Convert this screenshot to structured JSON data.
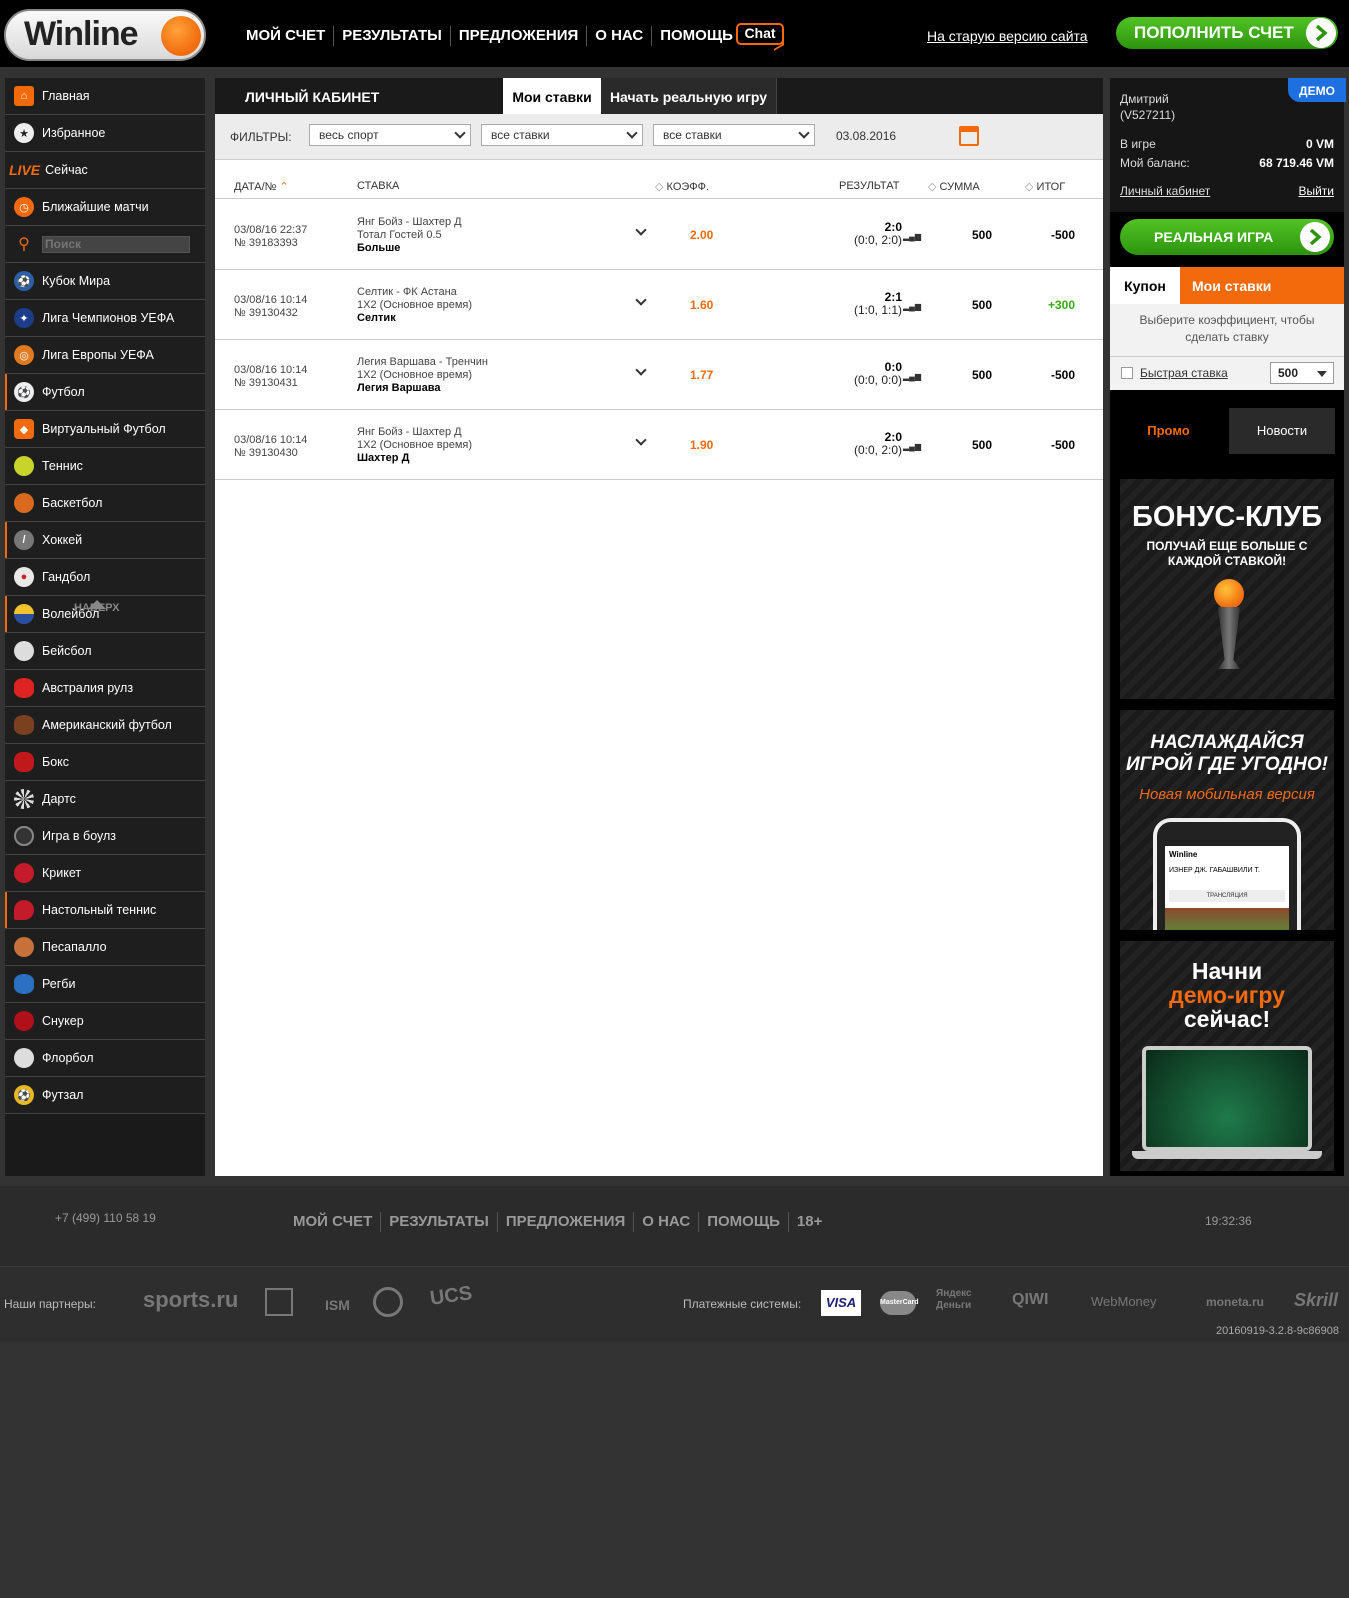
{
  "header": {
    "logo_text": "Winline",
    "nav": [
      "МОЙ СЧЕТ",
      "РЕЗУЛЬТАТЫ",
      "ПРЕДЛОЖЕНИЯ",
      "О НАС",
      "ПОМОЩЬ"
    ],
    "chat": "Chat",
    "old_site": "На старую версию сайта",
    "deposit": "ПОПОЛНИТЬ СЧЕТ"
  },
  "sidebar": {
    "items": [
      "Главная",
      "Избранное",
      "Сейчас",
      "Ближайшие матчи",
      "Кубок Мира",
      "Лига Чемпионов УЕФА",
      "Лига Европы УЕФА",
      "Футбол",
      "Виртуальный Футбол",
      "Теннис",
      "Баскетбол",
      "Хоккей",
      "Гандбол",
      "Волейбол",
      "Бейсбол",
      "Австралия рулз",
      "Американский футбол",
      "Бокс",
      "Дартс",
      "Игра в боулз",
      "Крикет",
      "Настольный теннис",
      "Песапалло",
      "Регби",
      "Снукер",
      "Флорбол",
      "Футзал"
    ],
    "live_label": "LIVE",
    "search_placeholder": "Поиск",
    "to_top": "НАВЕРХ"
  },
  "main": {
    "title": "ЛИЧНЫЙ КАБИНЕТ",
    "tab_mybets": "Мои ставки",
    "tab_realgame": "Начать реальную игру",
    "filters_label": "ФИЛЬТРЫ:",
    "filter1": "весь спорт",
    "filter2": "все ставки",
    "filter3": "все ставки",
    "date": "03.08.2016",
    "columns": {
      "date": "ДАТА/№",
      "bet": "СТАВКА",
      "coef": "КОЭФФ.",
      "result": "РЕЗУЛЬТАТ",
      "sum": "СУММА",
      "total": "ИТОГ"
    },
    "bets": [
      {
        "date": "03/08/16 22:37",
        "num": "№ 39183393",
        "event": "Янг Бойз - Шахтер Д",
        "market": "Тотал Гостей 0.5",
        "pick": "Больше",
        "coef": "2.00",
        "score": "2:0",
        "halves": "(0:0, 2:0)",
        "sum": "500",
        "total": "-500",
        "win": false
      },
      {
        "date": "03/08/16 10:14",
        "num": "№ 39130432",
        "event": "Селтик - ФК Астана",
        "market": "1X2 (Основное время)",
        "pick": "Селтик",
        "coef": "1.60",
        "score": "2:1",
        "halves": "(1:0, 1:1)",
        "sum": "500",
        "total": "+300",
        "win": true
      },
      {
        "date": "03/08/16 10:14",
        "num": "№ 39130431",
        "event": "Легия Варшава - Тренчин",
        "market": "1X2 (Основное время)",
        "pick": "Легия Варшава",
        "coef": "1.77",
        "score": "0:0",
        "halves": "(0:0, 0:0)",
        "sum": "500",
        "total": "-500",
        "win": false
      },
      {
        "date": "03/08/16 10:14",
        "num": "№ 39130430",
        "event": "Янг Бойз - Шахтер Д",
        "market": "1X2 (Основное время)",
        "pick": "Шахтер Д",
        "coef": "1.90",
        "score": "2:0",
        "halves": "(0:0, 2:0)",
        "sum": "500",
        "total": "-500",
        "win": false
      }
    ]
  },
  "account": {
    "name": "Дмитрий",
    "id": "(V527211)",
    "demo": "ДЕМО",
    "in_game_label": "В игре",
    "in_game_value": "0 VM",
    "balance_label": "Мой баланс:",
    "balance_value": "68 719.46 VM",
    "cabinet_link": "Личный кабинет",
    "logout": "Выйти",
    "real_game": "РЕАЛЬНАЯ ИГРА"
  },
  "coupon": {
    "tab_coupon": "Купон",
    "tab_mybets": "Мои ставки",
    "hint": "Выберите коэффициент, чтобы сделать ставку",
    "quick_label": "Быстрая ставка",
    "quick_value": "500"
  },
  "promo": {
    "tab_promo": "Промо",
    "tab_news": "Новости",
    "banner1_title": "БОНУС-КЛУБ",
    "banner1_sub": "ПОЛУЧАЙ ЕЩЕ БОЛЬШЕ С КАЖДОЙ СТАВКОЙ!",
    "banner2_title": "НАСЛАЖДАЙСЯ ИГРОЙ ГДЕ УГОДНО!",
    "banner2_sub": "Новая мобильная версия",
    "banner2_app_logo": "Winline",
    "banner2_row": "ИЗНЕР ДЖ. ГАБАШВИЛИ Т.",
    "banner2_bar": "ТРАНСЛЯЦИЯ",
    "banner3_line1": "Начни",
    "banner3_line2": "демо-игру",
    "banner3_line3": "сейчас!"
  },
  "footer": {
    "phone": "+7 (499) 110 58 19",
    "nav": [
      "МОЙ СЧЕТ",
      "РЕЗУЛЬТАТЫ",
      "ПРЕДЛОЖЕНИЯ",
      "О НАС",
      "ПОМОЩЬ",
      "18+"
    ],
    "clock": "19:32:36",
    "partners_label": "Наши партнеры:",
    "partners": [
      "sports.ru",
      "ISM",
      "UCS"
    ],
    "payments_label": "Платежные системы:",
    "payments": [
      "VISA",
      "MasterCard",
      "Яндекс Деньги",
      "QIWI",
      "WebMoney",
      "moneta.ru",
      "Skrill"
    ],
    "version": "20160919-3.2.8-9c86908"
  },
  "colors": {
    "accent": "#f26a0c",
    "green": "#3aa818",
    "win": "#3aa818",
    "demo": "#1e6fe0"
  }
}
